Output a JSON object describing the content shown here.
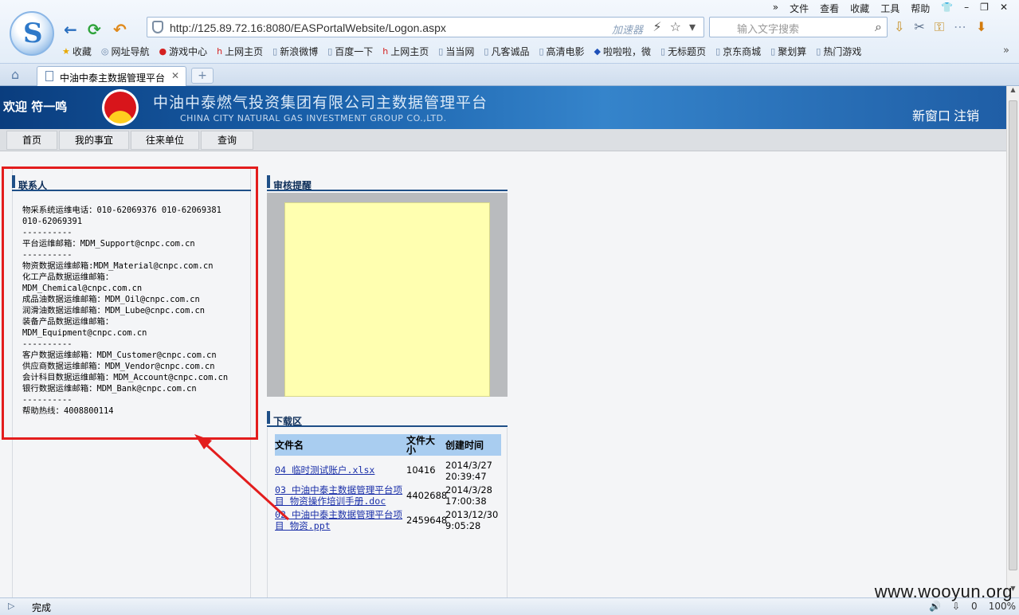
{
  "menu": [
    "文件",
    "查看",
    "收藏",
    "工具",
    "帮助"
  ],
  "address": {
    "url": "http://125.89.72.16:8080/EASPortalWebsite/Logon.aspx",
    "accelerator": "加速器"
  },
  "search": {
    "placeholder": "输入文字搜索"
  },
  "favorites": [
    "收藏",
    "网址导航",
    "游戏中心",
    "上网主页",
    "新浪微博",
    "百度一下",
    "上网主页",
    "当当网",
    "凡客诚品",
    "高清电影",
    "啦啦啦，微",
    "无标题页",
    "京东商城",
    "聚划算",
    "热门游戏"
  ],
  "tab": {
    "title": "中油中泰主数据管理平台"
  },
  "banner": {
    "welcome": "欢迎 符一鸣",
    "title": "中油中泰燃气投资集团有限公司主数据管理平台",
    "subtitle": "CHINA CITY NATURAL GAS INVESTMENT GROUP CO.,LTD.",
    "new_window": "新窗口",
    "logout": "注销"
  },
  "nav": [
    "首页",
    "我的事宜",
    "往来单位",
    "查询"
  ],
  "contacts": {
    "heading": "联系人",
    "lines": [
      "物采系统运维电话：010-62069376 010-62069381",
      "010-62069391",
      "----------",
      "平台运维邮箱：MDM_Support@cnpc.com.cn",
      "----------",
      "物资数据运维邮箱:MDM_Material@cnpc.com.cn",
      "化工产品数据运维邮箱：",
      "MDM_Chemical@cnpc.com.cn",
      "成品油数据运维邮箱：MDM_Oil@cnpc.com.cn",
      "润滑油数据运维邮箱：MDM_Lube@cnpc.com.cn",
      "装备产品数据运维邮箱：",
      "MDM_Equipment@cnpc.com.cn",
      "----------",
      "客户数据运维邮箱：MDM_Customer@cnpc.com.cn",
      "供应商数据运维邮箱：MDM_Vendor@cnpc.com.cn",
      "会计科目数据运维邮箱：MDM_Account@cnpc.com.cn",
      "银行数据运维邮箱：MDM_Bank@cnpc.com.cn",
      "----------",
      "帮助热线：4008800114"
    ]
  },
  "review": {
    "heading": "审核提醒"
  },
  "downloads": {
    "heading": "下载区",
    "columns": [
      "文件名",
      "文件大小",
      "创建时间"
    ],
    "rows": [
      {
        "name": "04 临时测试账户.xlsx",
        "size": "10416",
        "date": "2014/3/27",
        "time": "20:39:47"
      },
      {
        "name": "03 中油中泰主数据管理平台项目 物资操作培训手册.doc",
        "size": "4402688",
        "date": "2014/3/28",
        "time": "17:00:38"
      },
      {
        "name": "02 中油中泰主数据管理平台项目 物资.ppt",
        "size": "2459648",
        "date": "2013/12/30",
        "time": "9:05:28"
      }
    ]
  },
  "status": {
    "text": "完成",
    "zoom": "100%",
    "count": "0"
  },
  "watermark": "www.wooyun.org",
  "colors": {
    "banner": "#185ea8",
    "highlight": "#e31d1d",
    "review_bg": "#ffffb0",
    "table_header": "#a9cdf0"
  }
}
